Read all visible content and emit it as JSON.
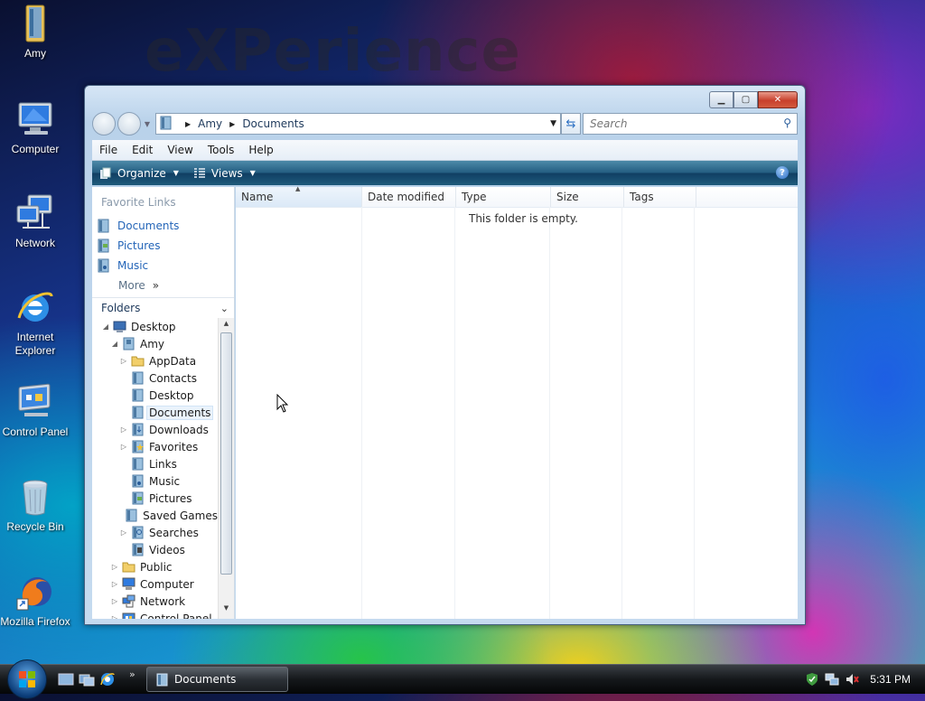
{
  "wallpaper": {
    "watermark": "eXPerience"
  },
  "desktop_icons": [
    {
      "label": "Amy",
      "icon": "user-folder-icon"
    },
    {
      "label": "Computer",
      "icon": "computer-icon"
    },
    {
      "label": "Network",
      "icon": "network-icon"
    },
    {
      "label": "Internet Explorer",
      "icon": "internet-explorer-icon"
    },
    {
      "label": "Control Panel",
      "icon": "control-panel-icon"
    },
    {
      "label": "Recycle Bin",
      "icon": "recycle-bin-icon"
    },
    {
      "label": "Mozilla Firefox",
      "icon": "firefox-icon"
    }
  ],
  "window": {
    "title": "Documents",
    "address": {
      "crumbs": [
        "Amy",
        "Documents"
      ]
    },
    "search": {
      "placeholder": "Search"
    },
    "menu": [
      "File",
      "Edit",
      "View",
      "Tools",
      "Help"
    ],
    "commands": {
      "organize": "Organize",
      "views": "Views"
    },
    "favorites": {
      "header": "Favorite Links",
      "items": [
        "Documents",
        "Pictures",
        "Music"
      ],
      "more": "More"
    },
    "folders": {
      "header": "Folders",
      "tree": [
        {
          "label": "Desktop",
          "depth": 0,
          "expanded": true,
          "icon": "desktop-icon"
        },
        {
          "label": "Amy",
          "depth": 1,
          "expanded": true,
          "icon": "user-folder-icon"
        },
        {
          "label": "AppData",
          "depth": 2,
          "expandable": true,
          "icon": "folder-icon"
        },
        {
          "label": "Contacts",
          "depth": 2,
          "icon": "contacts-icon"
        },
        {
          "label": "Desktop",
          "depth": 2,
          "icon": "desktop-folder-icon"
        },
        {
          "label": "Documents",
          "depth": 2,
          "selected": true,
          "icon": "documents-icon"
        },
        {
          "label": "Downloads",
          "depth": 2,
          "expandable": true,
          "icon": "downloads-icon"
        },
        {
          "label": "Favorites",
          "depth": 2,
          "expandable": true,
          "icon": "favorites-icon"
        },
        {
          "label": "Links",
          "depth": 2,
          "icon": "links-icon"
        },
        {
          "label": "Music",
          "depth": 2,
          "icon": "music-icon"
        },
        {
          "label": "Pictures",
          "depth": 2,
          "icon": "pictures-icon"
        },
        {
          "label": "Saved Games",
          "depth": 2,
          "icon": "saved-games-icon"
        },
        {
          "label": "Searches",
          "depth": 2,
          "expandable": true,
          "icon": "searches-icon"
        },
        {
          "label": "Videos",
          "depth": 2,
          "icon": "videos-icon"
        },
        {
          "label": "Public",
          "depth": 1,
          "expandable": true,
          "icon": "folder-icon"
        },
        {
          "label": "Computer",
          "depth": 1,
          "expandable": true,
          "icon": "computer-icon"
        },
        {
          "label": "Network",
          "depth": 1,
          "expandable": true,
          "icon": "network-icon"
        },
        {
          "label": "Control Panel",
          "depth": 1,
          "expandable": true,
          "icon": "control-panel-icon"
        }
      ]
    },
    "columns": [
      "Name",
      "Date modified",
      "Type",
      "Size",
      "Tags"
    ],
    "sorted_column": "Name",
    "empty_text": "This folder is empty."
  },
  "taskbar": {
    "task_label": "Documents",
    "clock": "5:31 PM"
  }
}
